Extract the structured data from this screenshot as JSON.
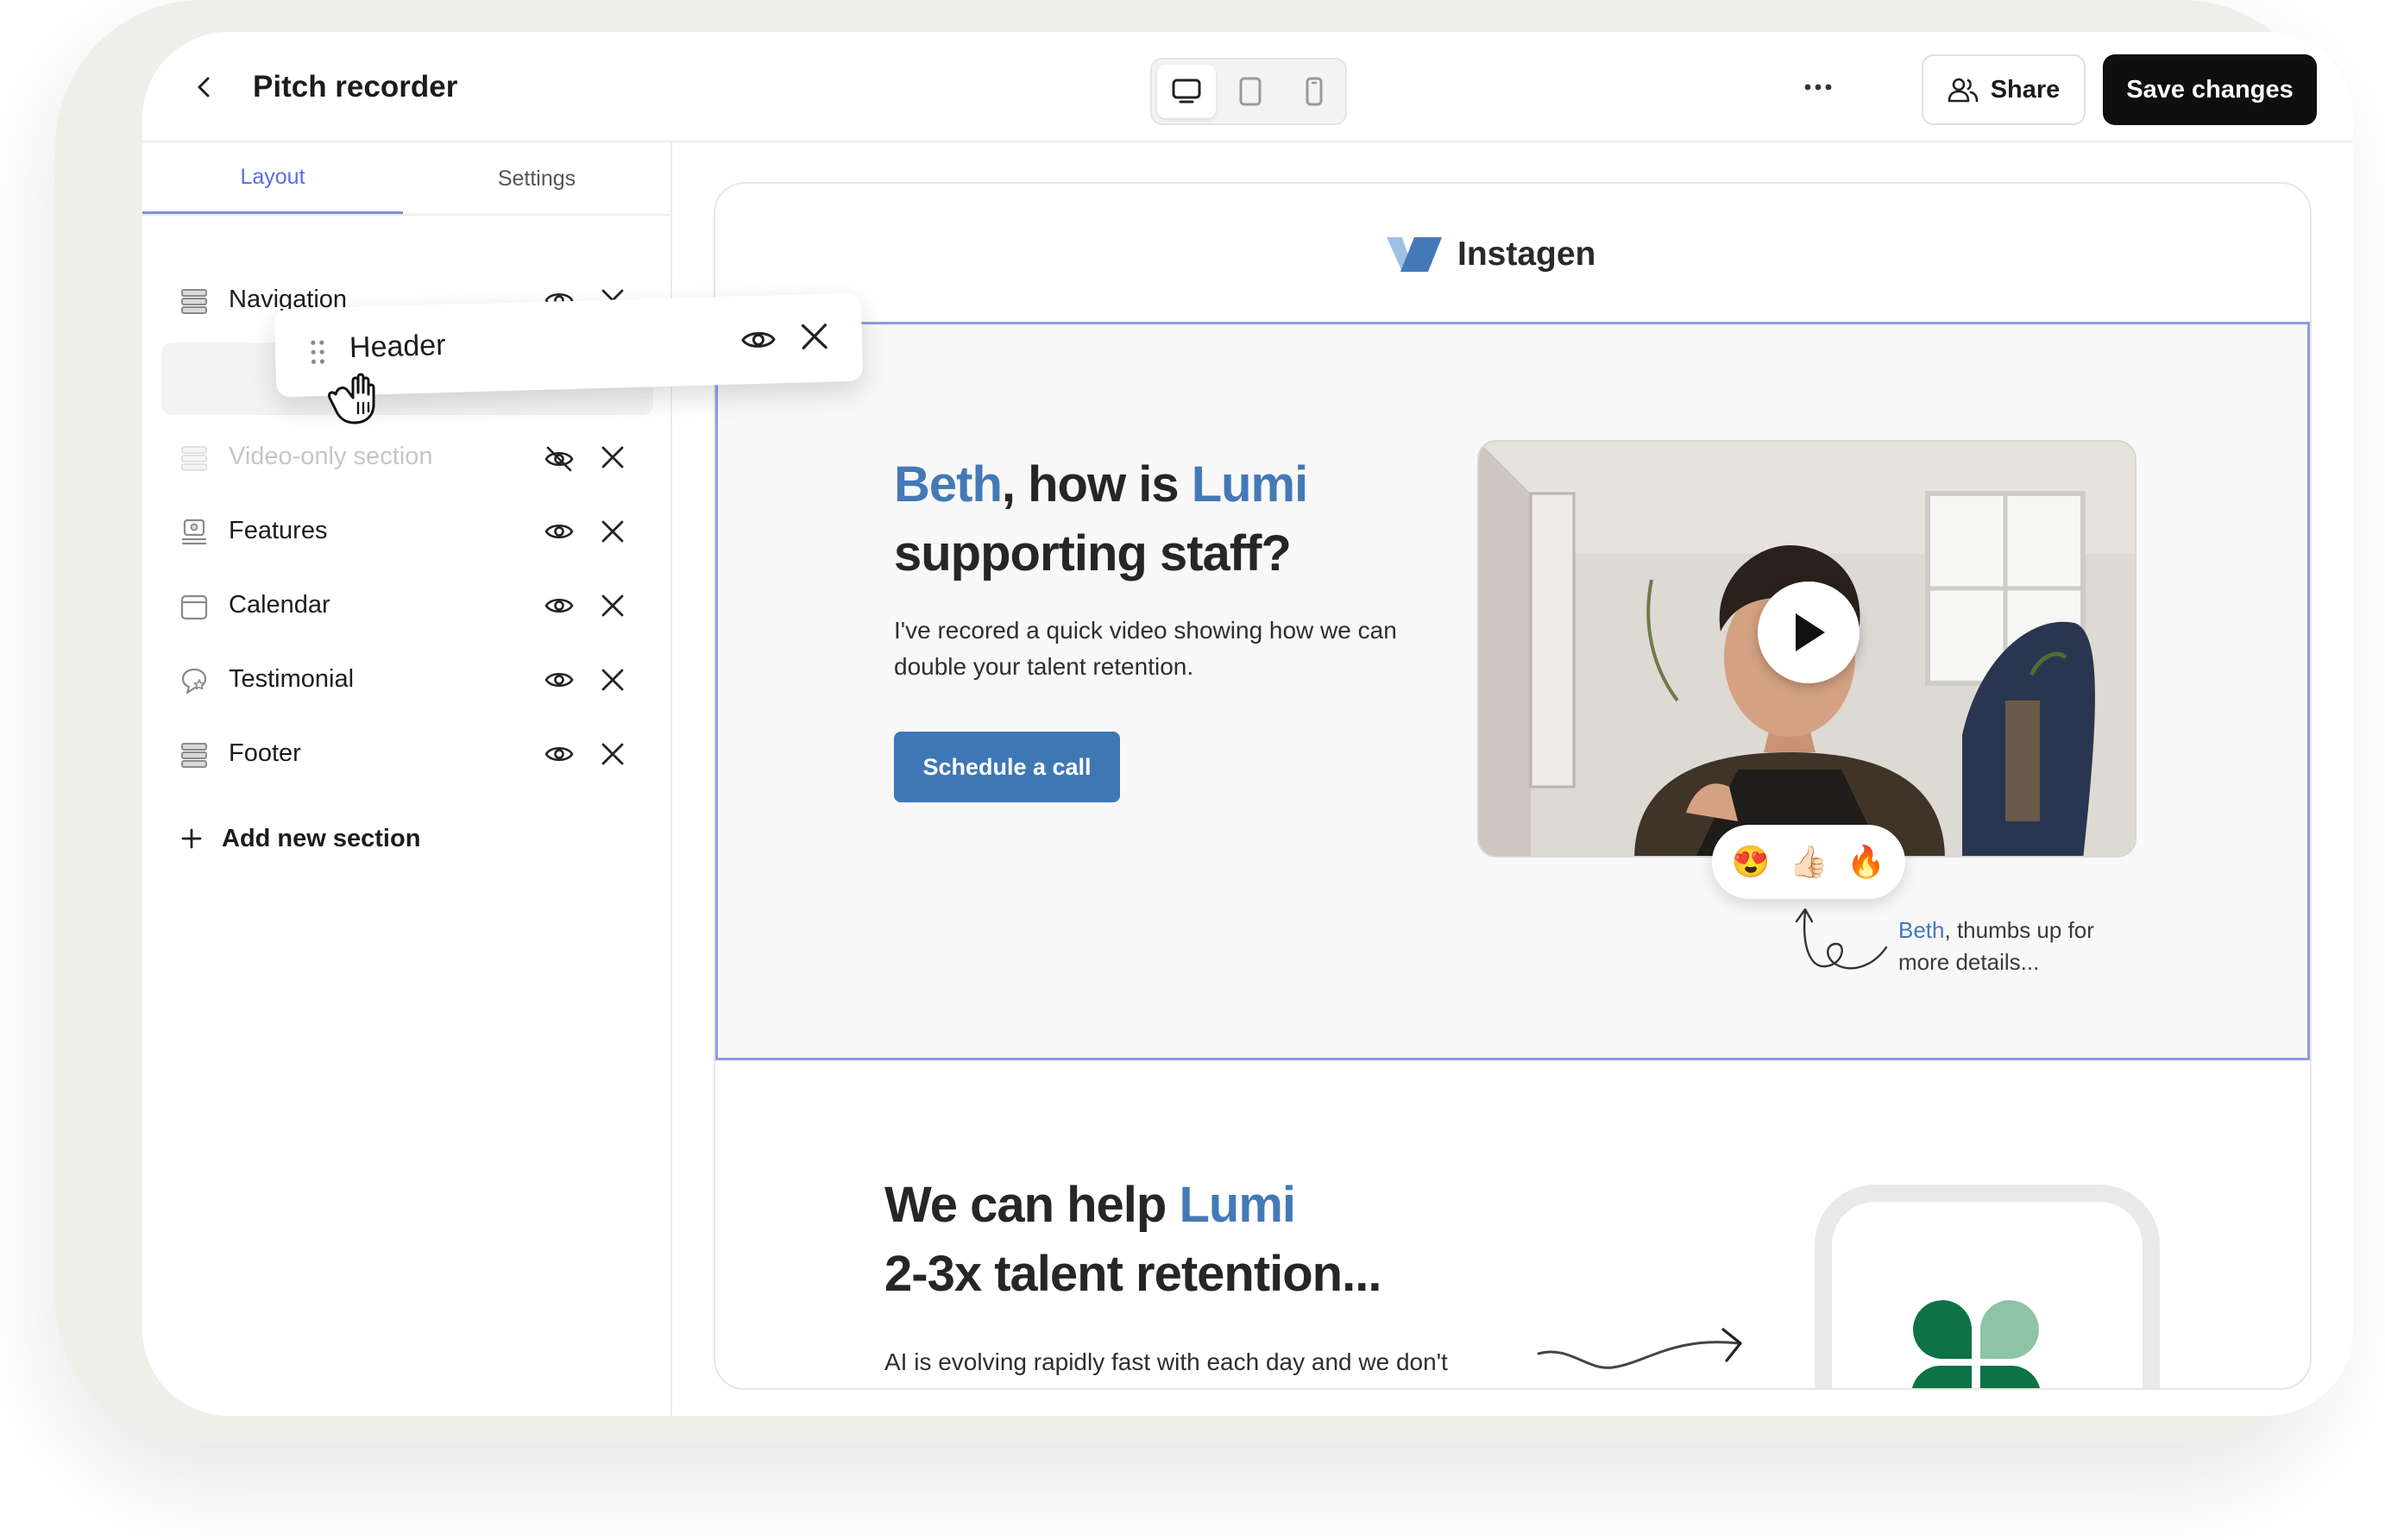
{
  "header": {
    "title": "Pitch recorder",
    "share_label": "Share",
    "save_label": "Save changes",
    "device_modes": [
      "desktop",
      "tablet",
      "mobile"
    ],
    "active_device": "desktop"
  },
  "sidebar": {
    "tabs": [
      {
        "label": "Layout",
        "active": true
      },
      {
        "label": "Settings",
        "active": false
      }
    ],
    "sections": [
      {
        "label": "Navigation",
        "icon": "stack-icon",
        "visible": true
      },
      {
        "label": "Video-only section",
        "icon": "stack-icon",
        "visible": false
      },
      {
        "label": "Features",
        "icon": "features-icon",
        "visible": true
      },
      {
        "label": "Calendar",
        "icon": "calendar-icon",
        "visible": true
      },
      {
        "label": "Testimonial",
        "icon": "testimonial-icon",
        "visible": true
      },
      {
        "label": "Footer",
        "icon": "stack-icon",
        "visible": true
      }
    ],
    "dragging": {
      "label": "Header"
    },
    "add_label": "Add new section"
  },
  "preview": {
    "brand": "Instagen",
    "hero": {
      "title_name": "Beth",
      "title_mid": ", how is ",
      "title_company": "Lumi",
      "title_end": "supporting staff?",
      "subtitle": "I've recored a quick video showing how we can double your talent retention.",
      "cta": "Schedule a call",
      "reactions": [
        "😍",
        "👍🏻",
        "🔥"
      ],
      "note_name": "Beth",
      "note_rest": ", thumbs up for more details..."
    },
    "section2": {
      "title_start": "We can help ",
      "title_company": "Lumi",
      "title_end": "2-3x talent retention...",
      "body": "AI is evolving rapidly fast with each day and we don't"
    }
  },
  "colors": {
    "accent": "#4479b7",
    "tab_active": "#5b6ee1",
    "selection_border": "#8f9ae8",
    "save_button": "#0f0f0f",
    "clover_dark": "#0e7247",
    "clover_light": "#8fc3a6"
  }
}
